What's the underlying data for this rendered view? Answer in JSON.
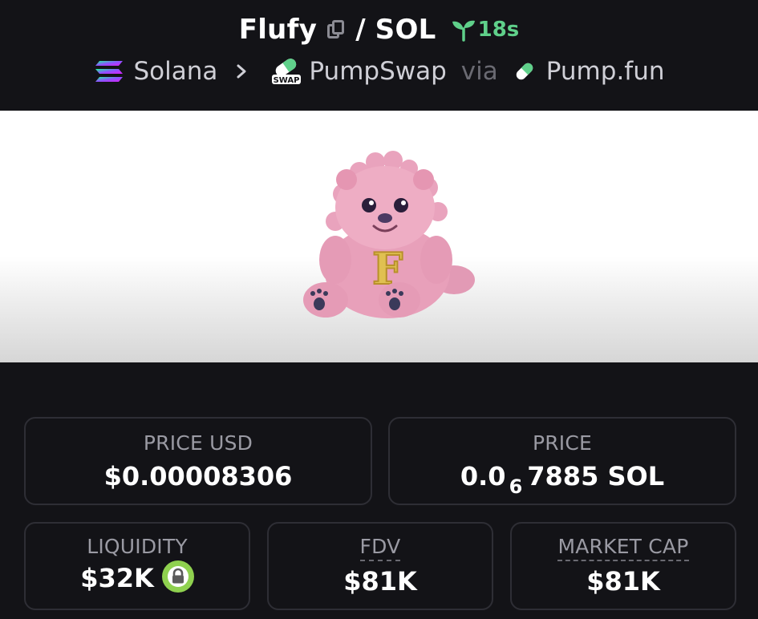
{
  "header": {
    "token_symbol": "Flufy",
    "separator": "/",
    "quote_symbol": "SOL",
    "age": "18s",
    "breadcrumb": {
      "chain": "Solana",
      "dex": "PumpSwap",
      "via_label": "via",
      "launchpad": "Pump.fun",
      "swap_badge": "SWAP"
    }
  },
  "banner": {
    "mascot_letter": "F"
  },
  "stats": {
    "price_usd": {
      "label": "PRICE USD",
      "value": "$0.00008306"
    },
    "price": {
      "label": "PRICE",
      "prefix": "0.0",
      "zeros": "6",
      "rest": "7885 SOL"
    },
    "liquidity": {
      "label": "LIQUIDITY",
      "value": "$32K"
    },
    "fdv": {
      "label": "FDV",
      "value": "$81K"
    },
    "market_cap": {
      "label": "MARKET CAP",
      "value": "$81K"
    }
  },
  "colors": {
    "background": "#131317",
    "card_border": "#2e2e35",
    "label_gray": "#9a9aa3",
    "age_green": "#5fd08a",
    "lock_green": "#8fd14f"
  },
  "icons": [
    "copy-icon",
    "sprout-icon",
    "solana-icon",
    "chevron-right-icon",
    "pumpswap-icon",
    "pill-icon",
    "lock-icon"
  ]
}
